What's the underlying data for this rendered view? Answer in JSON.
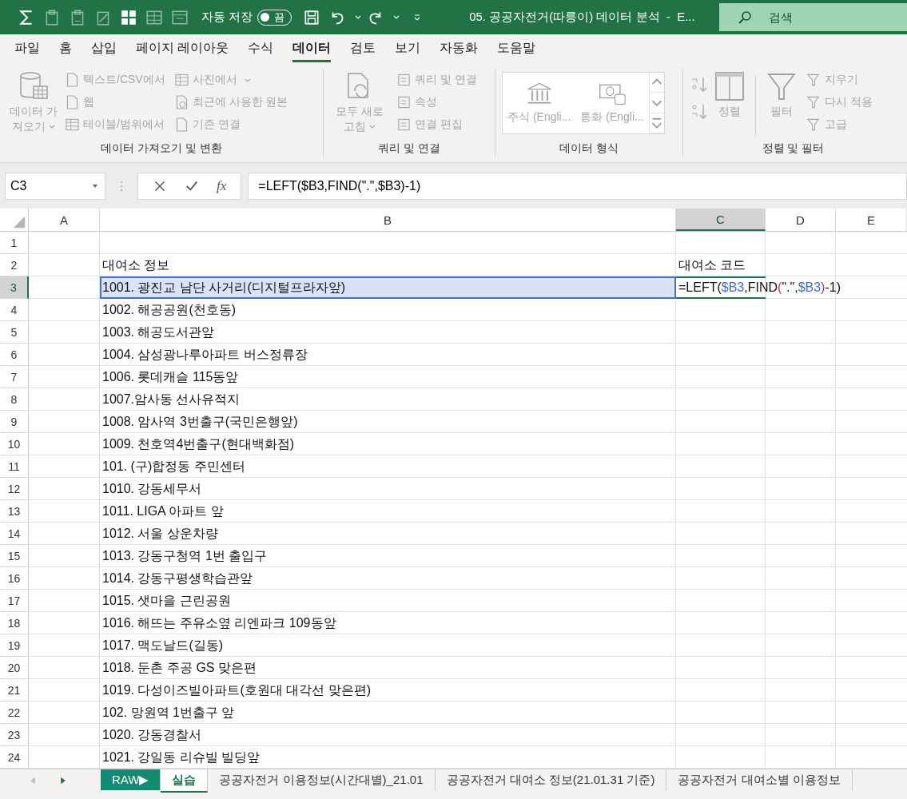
{
  "title_bar": {
    "autosave_label": "자동 저장",
    "autosave": {
      "on": false,
      "state_label": "끔"
    },
    "title": "05. 공공자전거(따릉이) 데이터 분석  -  E...",
    "search": {
      "placeholder": "검색"
    }
  },
  "menu_tabs": [
    {
      "label": "파일",
      "selected": false
    },
    {
      "label": "홈",
      "selected": false
    },
    {
      "label": "삽입",
      "selected": false
    },
    {
      "label": "페이지 레이아웃",
      "selected": false
    },
    {
      "label": "수식",
      "selected": false
    },
    {
      "label": "데이터",
      "selected": true
    },
    {
      "label": "검토",
      "selected": false
    },
    {
      "label": "보기",
      "selected": false
    },
    {
      "label": "자동화",
      "selected": false
    },
    {
      "label": "도움말",
      "selected": false
    }
  ],
  "ribbon": {
    "get_data": {
      "label": "데이터 가져오기 및 변환",
      "main": {
        "label": "데이터 가져오기",
        "dropdown": true,
        "disabled": true
      },
      "items": [
        {
          "label": "텍스트/CSV에서",
          "disabled": true
        },
        {
          "label": "웹",
          "disabled": true
        },
        {
          "label": "테이블/범위에서",
          "disabled": true
        },
        {
          "label": "사진에서",
          "dropdown": true,
          "disabled": true
        },
        {
          "label": "최근에 사용한 원본",
          "disabled": true
        },
        {
          "label": "기존 연결",
          "disabled": true
        }
      ]
    },
    "queries": {
      "label": "쿼리 및 연결",
      "main": {
        "label": "모두 새로 고침",
        "dropdown": true,
        "disabled": true
      },
      "items": [
        {
          "label": "쿼리 및 연결",
          "disabled": true
        },
        {
          "label": "속성",
          "disabled": true
        },
        {
          "label": "연결 편집",
          "disabled": true
        }
      ]
    },
    "data_types": {
      "label": "데이터 형식",
      "items": [
        {
          "label": "주식 (Engli...",
          "disabled": true
        },
        {
          "label": "통화 (Engli...",
          "disabled": true
        }
      ]
    },
    "sort_filter": {
      "label": "정렬 및 필터",
      "sort": {
        "label": "정렬",
        "disabled": true
      },
      "filter": {
        "label": "필터",
        "disabled": true
      },
      "items": [
        {
          "label": "지우기",
          "disabled": true
        },
        {
          "label": "다시 적용",
          "disabled": true
        },
        {
          "label": "고급",
          "disabled": true
        }
      ]
    }
  },
  "formula_bar": {
    "name_box": "C3",
    "fx_label": "fx",
    "formula": "=LEFT($B3,FIND(\".\",$B3)-1)"
  },
  "columns": [
    {
      "label": "A",
      "selected": false
    },
    {
      "label": "B",
      "selected": false
    },
    {
      "label": "C",
      "selected": true
    },
    {
      "label": "D",
      "selected": false
    },
    {
      "label": "E",
      "selected": false
    }
  ],
  "rows": [
    {
      "number": "1",
      "selected": false
    },
    {
      "number": "2",
      "selected": false,
      "b": "대여소 정보",
      "c": "대여소 코드"
    },
    {
      "number": "3",
      "selected": true,
      "b": "1001. 광진교 남단 사거리(디지털프라자앞)",
      "b_referenced": true,
      "c_formula": [
        {
          "text": "=LEFT("
        },
        {
          "text": "$B3",
          "color": "#3a6fd8"
        },
        {
          "text": ",FIND"
        },
        {
          "text": "(",
          "color": "#d0305a"
        },
        {
          "text": "\".\","
        },
        {
          "text": "$B3",
          "color": "#3a6fd8"
        },
        {
          "text": ")",
          "color": "#d0305a"
        },
        {
          "text": "-1)"
        }
      ]
    },
    {
      "number": "4",
      "selected": false,
      "b": "1002. 해공공원(천호동)"
    },
    {
      "number": "5",
      "selected": false,
      "b": "1003. 해공도서관앞"
    },
    {
      "number": "6",
      "selected": false,
      "b": "1004. 삼성광나루아파트 버스정류장"
    },
    {
      "number": "7",
      "selected": false,
      "b": "1006. 롯데캐슬 115동앞"
    },
    {
      "number": "8",
      "selected": false,
      "b": "1007.암사동 선사유적지"
    },
    {
      "number": "9",
      "selected": false,
      "b": "1008. 암사역 3번출구(국민은행앞)"
    },
    {
      "number": "10",
      "selected": false,
      "b": "1009. 천호역4번출구(현대백화점)"
    },
    {
      "number": "11",
      "selected": false,
      "b": "101. (구)합정동 주민센터"
    },
    {
      "number": "12",
      "selected": false,
      "b": "1010. 강동세무서"
    },
    {
      "number": "13",
      "selected": false,
      "b": "1011. LIGA 아파트 앞"
    },
    {
      "number": "14",
      "selected": false,
      "b": "1012. 서울 상운차량"
    },
    {
      "number": "15",
      "selected": false,
      "b": "1013. 강동구청역 1번 출입구"
    },
    {
      "number": "16",
      "selected": false,
      "b": "1014. 강동구평생학습관앞"
    },
    {
      "number": "17",
      "selected": false,
      "b": "1015. 샛마을 근린공원"
    },
    {
      "number": "18",
      "selected": false,
      "b": "1016. 해뜨는 주유소옆 리엔파크 109동앞"
    },
    {
      "number": "19",
      "selected": false,
      "b": "1017. 맥도날드(길동)"
    },
    {
      "number": "20",
      "selected": false,
      "b": "1018. 둔촌 주공 GS 맞은편"
    },
    {
      "number": "21",
      "selected": false,
      "b": "1019. 다성이즈빌아파트(호원대 대각선 맞은편)"
    },
    {
      "number": "22",
      "selected": false,
      "b": "102. 망원역 1번출구 앞"
    },
    {
      "number": "23",
      "selected": false,
      "b": "1020. 강동경찰서"
    },
    {
      "number": "24",
      "selected": false,
      "b": "1021. 강일동 리슈빌 빌딩앞"
    }
  ],
  "sheet_tabs": [
    {
      "label": "RAW▶",
      "selected": false,
      "color": "#138a72"
    },
    {
      "label": "실습",
      "selected": true
    },
    {
      "label": "공공자전거 이용정보(시간대별)_21.01",
      "selected": false
    },
    {
      "label": "공공자전거 대여소 정보(21.01.31 기준)",
      "selected": false
    },
    {
      "label": "공공자전거 대여소별 이용정보",
      "selected": false
    }
  ]
}
